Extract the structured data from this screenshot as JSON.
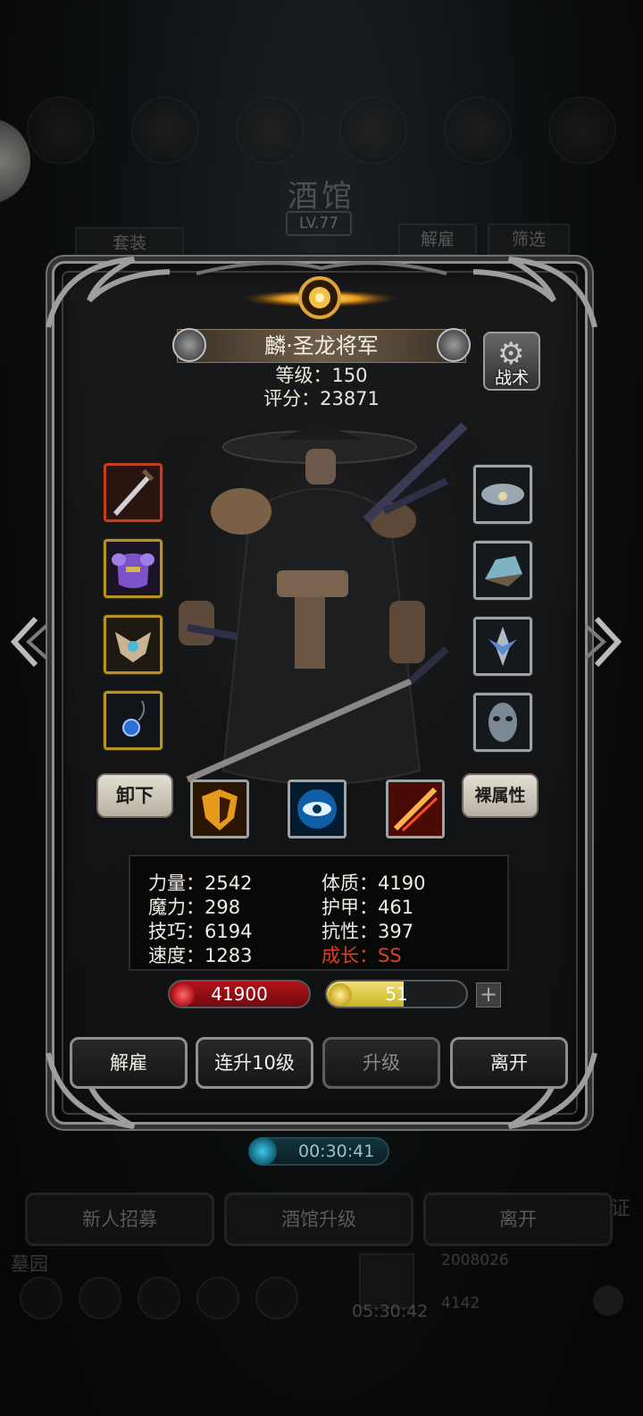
{
  "background": {
    "tavern_title": "酒馆",
    "tavern_level": "LV.77",
    "set_button": "套装",
    "dismiss_button": "解雇",
    "filter_button": "筛选",
    "bottom_buttons": [
      "新人招募",
      "酒馆升级",
      "离开"
    ],
    "left_label": "墓园",
    "right_label": "证",
    "gold": "2008026",
    "gems": "4142",
    "timer2": "05:30:42"
  },
  "hero": {
    "name": "麟·圣龙将军",
    "level_text": "等级：150",
    "score_text": "评分：23871",
    "tactics_label": "战术"
  },
  "equipment": {
    "left": [
      "sword",
      "chest-armor",
      "helmet",
      "amulet"
    ],
    "right": [
      "cloud-gem",
      "stone",
      "emblem",
      "mask"
    ]
  },
  "buttons": {
    "unequip": "卸下",
    "base_attributes": "裸属性"
  },
  "skills": [
    "shield-skill",
    "eye-skill",
    "slash-skill"
  ],
  "stats": {
    "strength": "力量：2542",
    "constitution": "体质：4190",
    "magic": "魔力：298",
    "armor": "护甲：461",
    "skill": "技巧：6194",
    "resistance": "抗性：397",
    "speed": "速度：1283",
    "growth": "成长：SS"
  },
  "bars": {
    "hp": "41900",
    "energy": "51",
    "energy_fraction": 0.55,
    "hp_color": "#b3131a",
    "energy_color": "#c9b51e"
  },
  "actions": {
    "dismiss": "解雇",
    "upgrade10": "连升10级",
    "upgrade": "升级",
    "leave": "离开"
  },
  "timer": "00:30:41"
}
